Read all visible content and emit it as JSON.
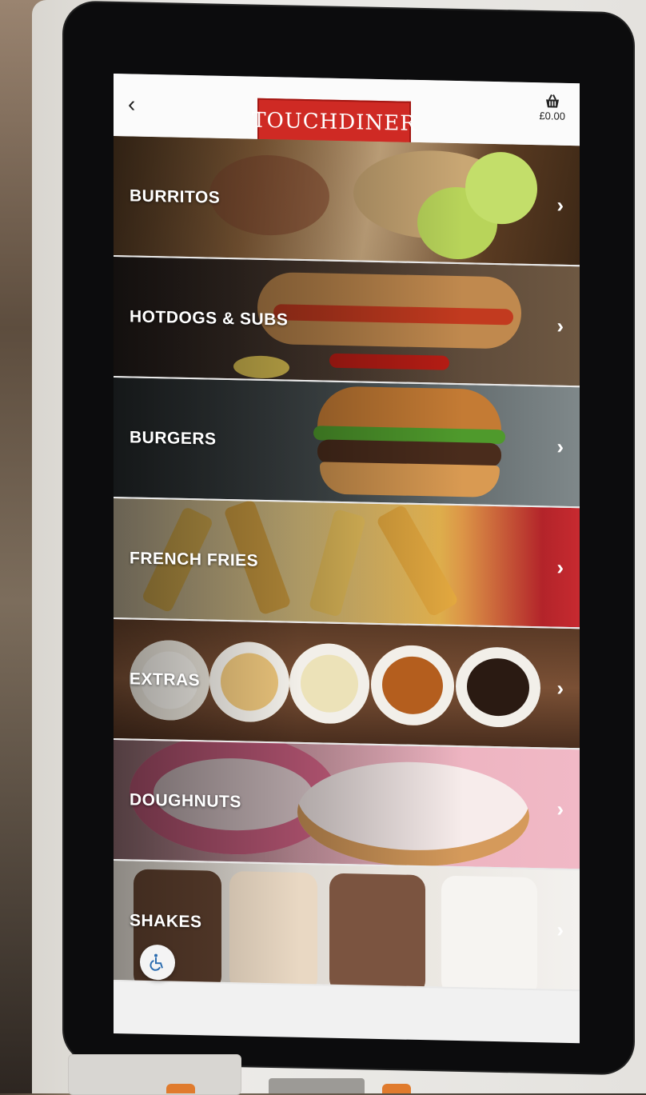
{
  "header": {
    "back_icon": "chevron-left-icon",
    "logo_text": "TOUCHDINER",
    "basket_icon": "basket-icon",
    "basket_total": "£0.00"
  },
  "categories": [
    {
      "label": "BURRITOS"
    },
    {
      "label": "HOTDOGS & SUBS"
    },
    {
      "label": "BURGERS"
    },
    {
      "label": "FRENCH FRIES"
    },
    {
      "label": "EXTRAS"
    },
    {
      "label": "DOUGHNUTS"
    },
    {
      "label": "SHAKES"
    }
  ],
  "accessibility": {
    "icon": "wheelchair-icon"
  },
  "colors": {
    "brand_red": "#cf2a24",
    "screen_bg": "#f1f1f1"
  }
}
